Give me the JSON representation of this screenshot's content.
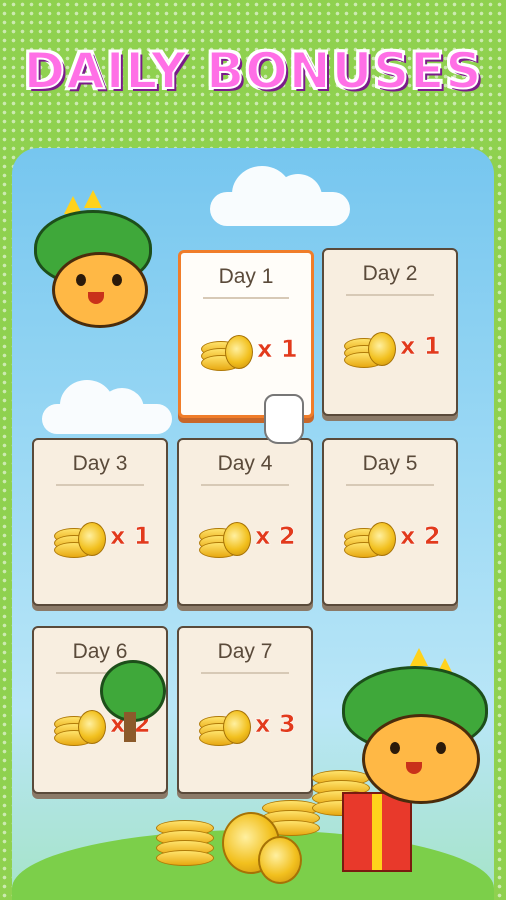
{
  "header": {
    "title": "DAILY BONUSES"
  },
  "days": [
    {
      "label": "Day 1",
      "multiplier": "x 1",
      "selected": true
    },
    {
      "label": "Day 2",
      "multiplier": "x 1",
      "selected": false
    },
    {
      "label": "Day 3",
      "multiplier": "x 1",
      "selected": false
    },
    {
      "label": "Day 4",
      "multiplier": "x 2",
      "selected": false
    },
    {
      "label": "Day 5",
      "multiplier": "x 2",
      "selected": false
    },
    {
      "label": "Day 6",
      "multiplier": "x 2",
      "selected": false
    },
    {
      "label": "Day 7",
      "multiplier": "x 3",
      "selected": false
    }
  ],
  "icons": {
    "reward": "gold-coin-stack-icon",
    "pointer": "pointing-hand-icon",
    "mascot": "dino-cat-mascot",
    "gift": "gift-box-icon"
  },
  "colors": {
    "title": "#ff6fe6",
    "selected_border": "#f07d2a",
    "multiplier": "#e23a1c",
    "card_bg": "#f8eee0"
  }
}
